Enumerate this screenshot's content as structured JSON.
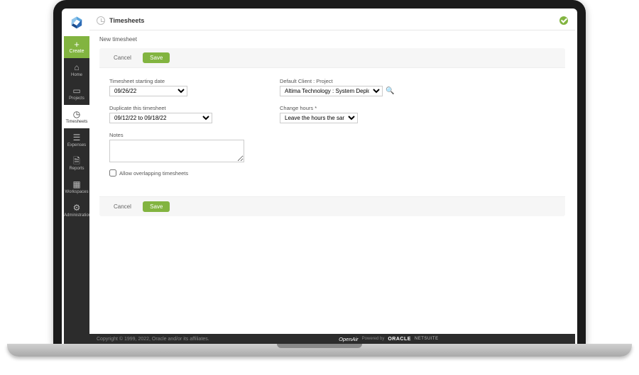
{
  "sidebar": {
    "create": "Create",
    "items": [
      {
        "label": "Home"
      },
      {
        "label": "Projects"
      },
      {
        "label": "Timesheets"
      },
      {
        "label": "Expenses"
      },
      {
        "label": "Reports"
      },
      {
        "label": "Workspaces"
      },
      {
        "label": "Administration"
      }
    ]
  },
  "header": {
    "title": "Timesheets"
  },
  "breadcrumb": "New timesheet",
  "buttons": {
    "cancel": "Cancel",
    "save": "Save"
  },
  "form": {
    "starting_date_label": "Timesheet starting date",
    "starting_date_value": "09/26/22",
    "duplicate_label": "Duplicate this timesheet",
    "duplicate_value": "09/12/22 to 09/18/22",
    "notes_label": "Notes",
    "notes_value": "",
    "overlap_label": "Allow overlapping timesheets",
    "client_label": "Default Client : Project",
    "client_value": "Altima Technology : System Deployment - T&M",
    "change_hours_label": "Change hours *",
    "change_hours_value": "Leave the hours the same"
  },
  "footer": {
    "copyright": "Copyright © 1999, 2022, Oracle and/or its affiliates.",
    "brand": "OpenAir",
    "powered": "Powered by",
    "oracle": "ORACLE",
    "netsuite": "NETSUITE"
  }
}
